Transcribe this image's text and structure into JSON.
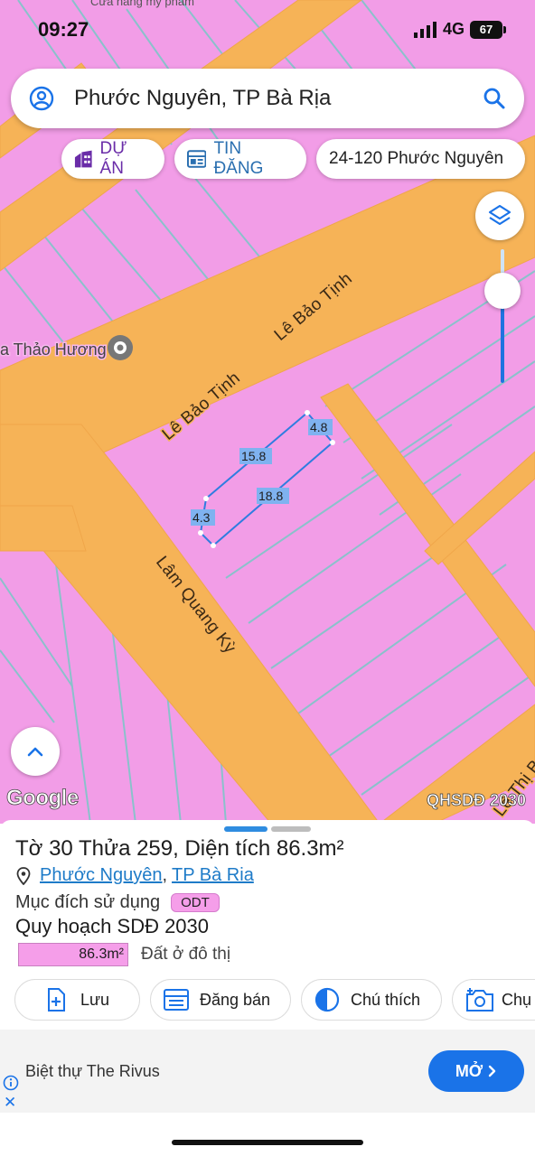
{
  "status": {
    "time": "09:27",
    "network": "4G",
    "battery": "67"
  },
  "search": {
    "query": "Phước Nguyên, TP Bà Rịa"
  },
  "chips": [
    {
      "label": "DỰ ÁN"
    },
    {
      "label": "TIN ĐĂNG"
    },
    {
      "label": "24-120 Phước Nguyên"
    }
  ],
  "map": {
    "top_text": "Cửa hàng mỹ phẩm",
    "roads": [
      "Lê Bảo Tịnh",
      "Lê Bảo Tịnh",
      "Lâm Quang Kỳ",
      "Lê Thị B"
    ],
    "poi": "a Thảo Hương",
    "parcel_dimensions": [
      "4.8",
      "15.8",
      "18.8",
      "4.3"
    ],
    "logo": "Google",
    "plan_tag": "QHSDĐ 2030",
    "colors": {
      "land": "#f29de7",
      "road": "#f6b357",
      "parcel_outline": "#2f7de0"
    }
  },
  "parcel": {
    "title": "Tờ 30 Thửa 259, Diện tích 86.3m²",
    "ward": "Phước Nguyên",
    "city": "TP Bà Ria",
    "purpose_label": "Mục đích sử dụng",
    "purpose_code": "ODT",
    "plan_label": "Quy hoạch SDĐ 2030",
    "legend_area": "86.3m²",
    "legend_text": "Đất ở đô thị"
  },
  "actions": [
    {
      "label": "Lưu",
      "icon": "save-icon"
    },
    {
      "label": "Đăng bán",
      "icon": "listing-icon"
    },
    {
      "label": "Chú thích",
      "icon": "contrast-icon"
    },
    {
      "label": "Chụ",
      "icon": "camera-icon"
    }
  ],
  "ad": {
    "text": "Biệt thự The Rivus",
    "button": "MỞ",
    "close": "✕"
  }
}
